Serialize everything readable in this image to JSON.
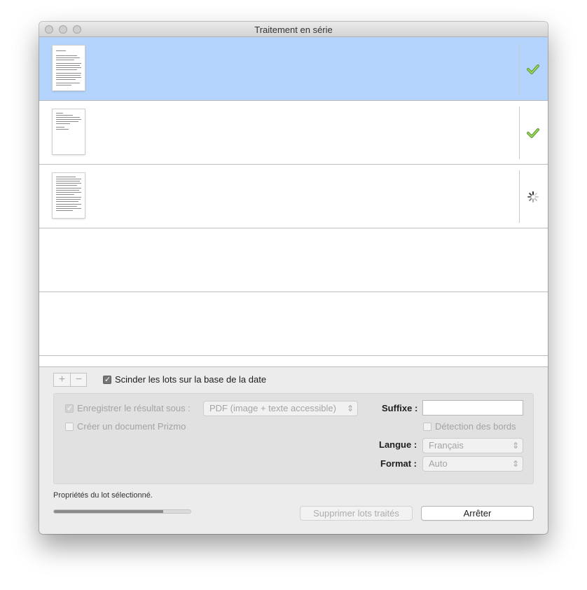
{
  "window": {
    "title": "Traitement en série"
  },
  "batches": [
    {
      "selected": true,
      "status": "done",
      "status_icon": "checkmark-icon"
    },
    {
      "selected": false,
      "status": "done",
      "status_icon": "checkmark-icon"
    },
    {
      "selected": false,
      "status": "processing",
      "status_icon": "spinner-icon"
    }
  ],
  "list_controls": {
    "add_label": "+",
    "remove_label": "−"
  },
  "split_by_date": {
    "label": "Scinder les lots sur la base de la date",
    "checked": true
  },
  "options": {
    "save_result": {
      "label": "Enregistrer le résultat sous :",
      "checked": true,
      "format_value": "PDF (image + texte accessible)"
    },
    "create_prizmo": {
      "label": "Créer un document Prizmo",
      "checked": false
    },
    "suffix": {
      "label": "Suffixe :",
      "value": ""
    },
    "edge_detection": {
      "label": "Détection des bords",
      "checked": false
    },
    "language": {
      "label": "Langue :",
      "value": "Français"
    },
    "format": {
      "label": "Format :",
      "value": "Auto"
    }
  },
  "footer": {
    "status_text": "Propriétés du lot sélectionné.",
    "progress": 0.8,
    "delete_processed_label": "Supprimer lots traités",
    "stop_label": "Arrêter"
  },
  "colors": {
    "selection": "#b4d4fd",
    "check_green": "#7cc341",
    "window_bg": "#ececec"
  }
}
